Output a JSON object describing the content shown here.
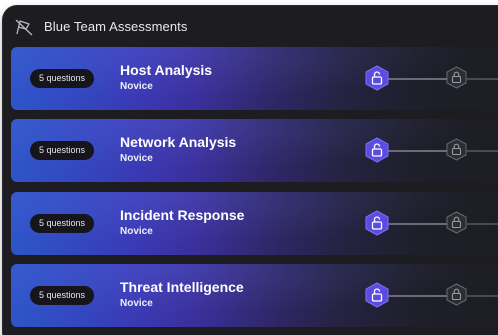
{
  "header": {
    "title": "Blue Team Assessments",
    "icon": "crossed-flag-icon"
  },
  "colors": {
    "panel_bg": "#1c1c21",
    "card_gradient_start": "#2f55c9",
    "card_gradient_mid": "#3a39b4",
    "active_node": "#5b4ce0",
    "locked_node": "#2c2c33"
  },
  "assessments": [
    {
      "questions": "5 questions",
      "title": "Host Analysis",
      "level": "Novice"
    },
    {
      "questions": "5 questions",
      "title": "Network Analysis",
      "level": "Novice"
    },
    {
      "questions": "5 questions",
      "title": "Incident Response",
      "level": "Novice"
    },
    {
      "questions": "5 questions",
      "title": "Threat Intelligence",
      "level": "Novice"
    }
  ],
  "node_icons": {
    "active": "unlock-icon",
    "locked": "lock-icon"
  }
}
